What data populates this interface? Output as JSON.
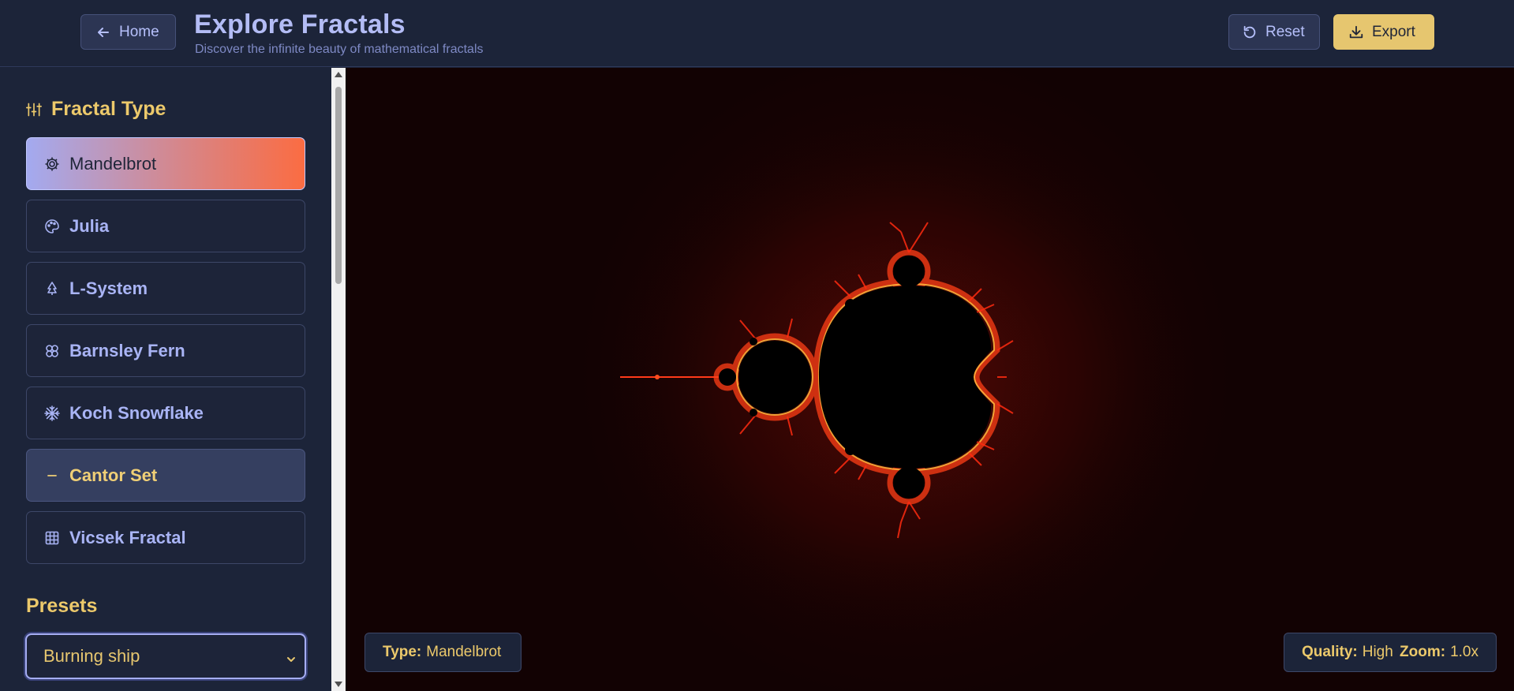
{
  "header": {
    "home_label": "Home",
    "title": "Explore Fractals",
    "subtitle": "Discover the infinite beauty of mathematical fractals",
    "reset_label": "Reset",
    "export_label": "Export"
  },
  "sidebar": {
    "fractal_type_title": "Fractal Type",
    "types": [
      {
        "label": "Mandelbrot",
        "icon": "gear-icon",
        "state": "active"
      },
      {
        "label": "Julia",
        "icon": "palette-icon",
        "state": "default"
      },
      {
        "label": "L-System",
        "icon": "tree-icon",
        "state": "default"
      },
      {
        "label": "Barnsley Fern",
        "icon": "flower-icon",
        "state": "default"
      },
      {
        "label": "Koch Snowflake",
        "icon": "snowflake-icon",
        "state": "default"
      },
      {
        "label": "Cantor Set",
        "icon": "minus-icon",
        "state": "hover"
      },
      {
        "label": "Vicsek Fractal",
        "icon": "grid-icon",
        "state": "default"
      }
    ],
    "presets_title": "Presets",
    "preset_selected": "Burning ship"
  },
  "canvas": {
    "type_label": "Type:",
    "type_value": "Mandelbrot",
    "quality_label": "Quality:",
    "quality_value": "High",
    "zoom_label": "Zoom:",
    "zoom_value": "1.0x"
  },
  "colors": {
    "accent": "#e6c66f",
    "background": "#1b2236",
    "fractal_edge": "#ff3a1a"
  }
}
